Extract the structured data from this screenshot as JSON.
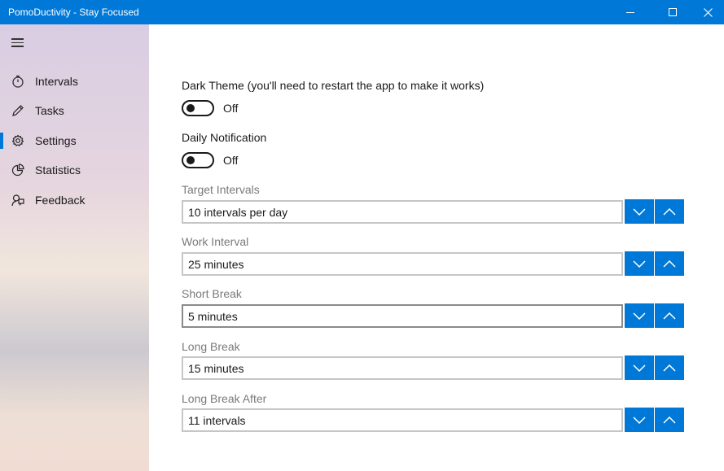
{
  "window": {
    "title": "PomoDuctivity - Stay Focused",
    "accent": "#0078d7",
    "controls": [
      "minimize",
      "maximize",
      "close"
    ]
  },
  "sidebar": {
    "items": [
      {
        "label": "Intervals",
        "icon": "stopwatch-icon",
        "selected": false
      },
      {
        "label": "Tasks",
        "icon": "pencil-icon",
        "selected": false
      },
      {
        "label": "Settings",
        "icon": "gear-icon",
        "selected": true
      },
      {
        "label": "Statistics",
        "icon": "pie-chart-icon",
        "selected": false
      },
      {
        "label": "Feedback",
        "icon": "feedback-icon",
        "selected": false
      }
    ]
  },
  "settings": {
    "dark_theme": {
      "label": "Dark Theme (you'll need to restart the app to make it works)",
      "state": "Off"
    },
    "daily_notification": {
      "label": "Daily Notification",
      "state": "Off"
    },
    "target_intervals": {
      "label": "Target Intervals",
      "value": "10 intervals per day"
    },
    "work_interval": {
      "label": "Work Interval",
      "value": "25 minutes"
    },
    "short_break": {
      "label": "Short Break",
      "value": "5 minutes"
    },
    "long_break": {
      "label": "Long Break",
      "value": "15 minutes"
    },
    "long_break_after": {
      "label": "Long Break After",
      "value": "11 intervals"
    }
  }
}
